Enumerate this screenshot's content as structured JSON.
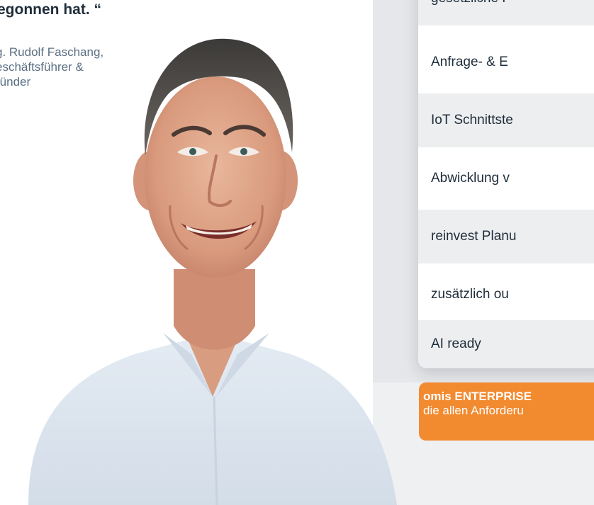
{
  "quote": {
    "tail": "egonnen hat. “",
    "attribution_lines": [
      "g. Rudolf Faschang,",
      "eschäftsführer &",
      "ründer"
    ]
  },
  "features": [
    {
      "label": "gesetzliche F"
    },
    {
      "label": "Anfrage- & E"
    },
    {
      "label": "IoT Schnittste"
    },
    {
      "label": "Abwicklung v"
    },
    {
      "label": "reinvest Planu"
    },
    {
      "label": "zusätzlich ou"
    },
    {
      "label": "AI ready"
    }
  ],
  "callout": {
    "title": "omis ENTERPRISE",
    "text": "die allen Anforderu"
  },
  "colors": {
    "accent_orange": "#f28a30",
    "text_dark": "#1f2d3a",
    "text_muted": "#5a6f82",
    "panel_gray": "#e6e7ea"
  }
}
